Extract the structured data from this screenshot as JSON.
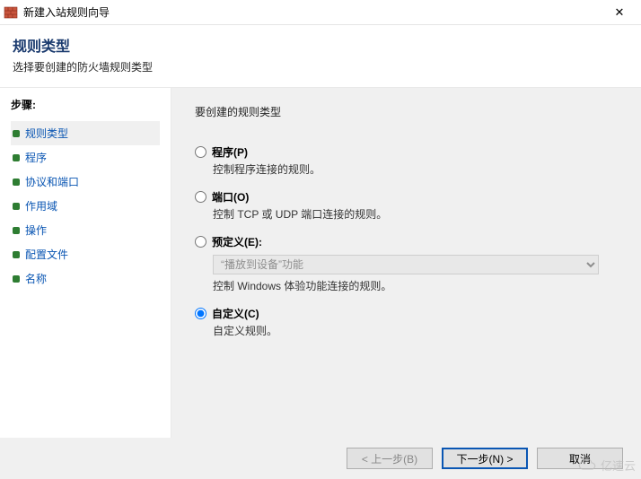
{
  "titlebar": {
    "title": "新建入站规则向导"
  },
  "header": {
    "heading": "规则类型",
    "subtitle": "选择要创建的防火墙规则类型"
  },
  "sidebar": {
    "steps_title": "步骤:",
    "items": [
      {
        "label": "规则类型"
      },
      {
        "label": "程序"
      },
      {
        "label": "协议和端口"
      },
      {
        "label": "作用域"
      },
      {
        "label": "操作"
      },
      {
        "label": "配置文件"
      },
      {
        "label": "名称"
      }
    ]
  },
  "main": {
    "prompt": "要创建的规则类型",
    "options": [
      {
        "label": "程序(P)",
        "desc": "控制程序连接的规则。"
      },
      {
        "label": "端口(O)",
        "desc": "控制 TCP 或 UDP 端口连接的规则。"
      },
      {
        "label": "预定义(E):",
        "desc": "控制 Windows 体验功能连接的规则。",
        "select_value": "“播放到设备”功能"
      },
      {
        "label": "自定义(C)",
        "desc": "自定义规则。"
      }
    ]
  },
  "footer": {
    "back": "< 上一步(B)",
    "next": "下一步(N) >",
    "cancel": "取消"
  },
  "watermark": {
    "text": "亿速云"
  }
}
